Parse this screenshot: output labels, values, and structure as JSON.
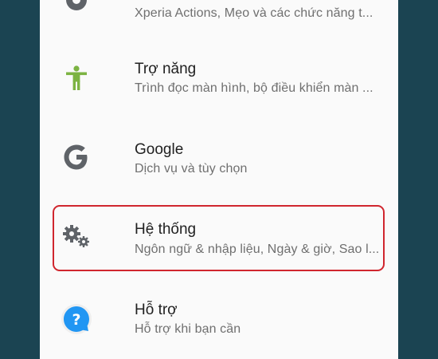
{
  "settings_items": [
    {
      "icon": "xperia-icon",
      "title": "",
      "subtitle": "Xperia Actions, Mẹo và các chức năng t..."
    },
    {
      "icon": "accessibility-icon",
      "title": "Trợ năng",
      "subtitle": "Trình đọc màn hình, bộ điều khiển màn ..."
    },
    {
      "icon": "google-icon",
      "title": "Google",
      "subtitle": "Dịch vụ và tùy chọn"
    },
    {
      "icon": "gears-icon",
      "title": "Hệ thống",
      "subtitle": "Ngôn ngữ & nhập liệu, Ngày & giờ, Sao l..."
    },
    {
      "icon": "help-icon",
      "title": "Hỗ trợ",
      "subtitle": "Hỗ trợ khi bạn cần"
    }
  ],
  "colors": {
    "background": "#1b4452",
    "panel": "#fafafa",
    "highlight": "#d0262e",
    "accessibility_green": "#7cb342",
    "google_gray": "#5f6368",
    "help_blue": "#2196f3"
  }
}
